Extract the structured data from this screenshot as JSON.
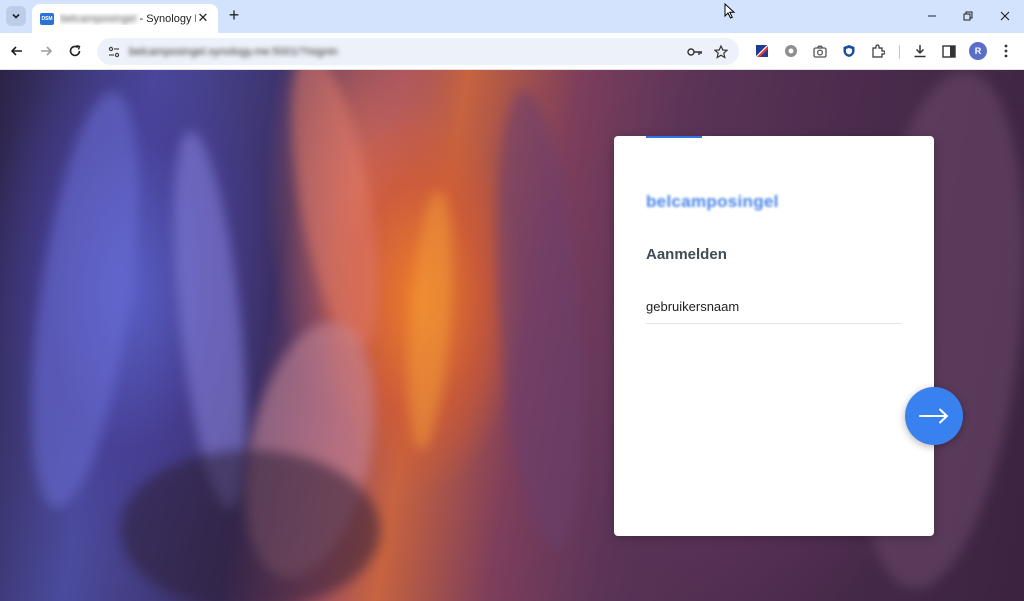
{
  "browser": {
    "tab": {
      "favicon_text": "DSM",
      "title_blurred": "belcamposingel",
      "title_suffix": " - Synology DiskS",
      "close_glyph": "✕"
    },
    "new_tab_glyph": "+",
    "window_controls": {
      "minimize": "—",
      "restore": "❐",
      "close": "✕"
    },
    "url_blurred": "belcamposingel.synology.me:5001/?/signin",
    "avatar_letter": "R"
  },
  "login": {
    "server_name": "belcamposingel",
    "title": "Aanmelden",
    "username_placeholder": "gebruikersnaam"
  },
  "colors": {
    "accent": "#3a81f0",
    "server_name": "#4a86e8",
    "title": "#414b55"
  }
}
